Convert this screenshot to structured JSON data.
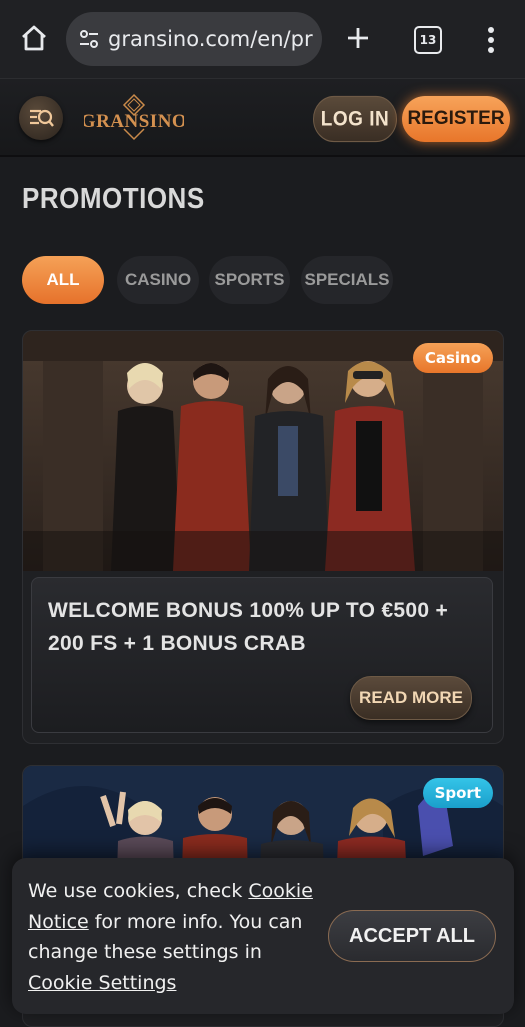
{
  "browser": {
    "url": "gransino.com/en/pro",
    "tab_count": "13"
  },
  "header": {
    "logo_text": "GRANSINO",
    "login_label": "LOG IN",
    "register_label": "REGISTER"
  },
  "page": {
    "title": "PROMOTIONS",
    "filters": [
      {
        "label": "ALL",
        "active": true
      },
      {
        "label": "CASINO",
        "active": false
      },
      {
        "label": "SPORTS",
        "active": false
      },
      {
        "label": "SPECIALS",
        "active": false
      }
    ]
  },
  "promos": [
    {
      "badge": "Casino",
      "title": "WELCOME BONUS 100% UP TO €500 + 200 FS + 1 BONUS CRAB",
      "button": "READ MORE"
    },
    {
      "badge": "Sport"
    }
  ],
  "cookie": {
    "text_1": "We use cookies, check ",
    "notice_link": "Cookie Notice",
    "text_2": " for more info. You can change these settings in ",
    "settings_link": "Cookie Settings",
    "accept_label": "ACCEPT ALL"
  },
  "colors": {
    "accent": "#e8762a",
    "sport_badge": "#1a9fcb",
    "background": "#1b1c1f"
  },
  "icons": [
    "home-icon",
    "site-info-icon",
    "new-tab-icon",
    "tab-switcher-icon",
    "more-vert-icon",
    "search-menu-icon"
  ]
}
